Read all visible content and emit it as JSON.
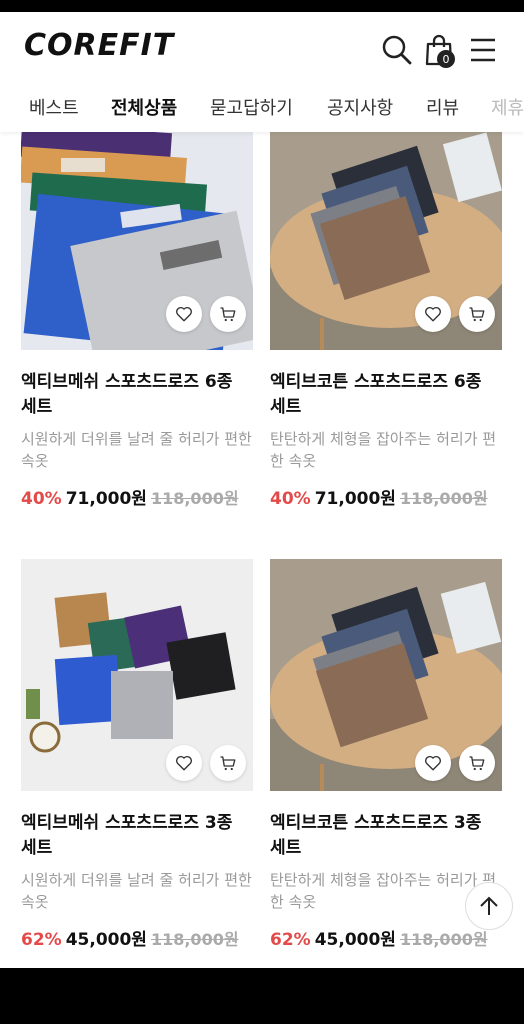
{
  "header": {
    "logo": "COREFIT",
    "cart_count": "0",
    "icons": {
      "search": "search-icon",
      "cart": "shopping-bag-icon",
      "menu": "hamburger-menu-icon"
    }
  },
  "tabs": [
    {
      "label": "베스트"
    },
    {
      "label": "전체상품"
    },
    {
      "label": "묻고답하기"
    },
    {
      "label": "공지사항"
    },
    {
      "label": "리뷰"
    },
    {
      "label": "제휴"
    }
  ],
  "products": [
    {
      "name": "엑티브메쉬 스포츠드로즈 6종 세트",
      "desc": "시원하게 더위를 날려 줄 허리가 편한 속옷",
      "discount": "40%",
      "price": "71,000원",
      "original": "118,000원"
    },
    {
      "name": "엑티브코튼 스포츠드로즈 6종 세트",
      "desc": "탄탄하게 체형을 잡아주는 허리가 편한 속옷",
      "discount": "40%",
      "price": "71,000원",
      "original": "118,000원"
    },
    {
      "name": "엑티브메쉬 스포츠드로즈 3종 세트",
      "desc": "시원하게 더위를 날려 줄 허리가 편한 속옷",
      "discount": "62%",
      "price": "45,000원",
      "original": "118,000원"
    },
    {
      "name": "엑티브코튼 스포츠드로즈 3종 세트",
      "desc": "탄탄하게 체형을 잡아주는 허리가 편한 속옷",
      "discount": "62%",
      "price": "45,000원",
      "original": "118,000원"
    }
  ],
  "colors": {
    "discount": "#e34a4a",
    "accent_dot": "#f0932b"
  }
}
